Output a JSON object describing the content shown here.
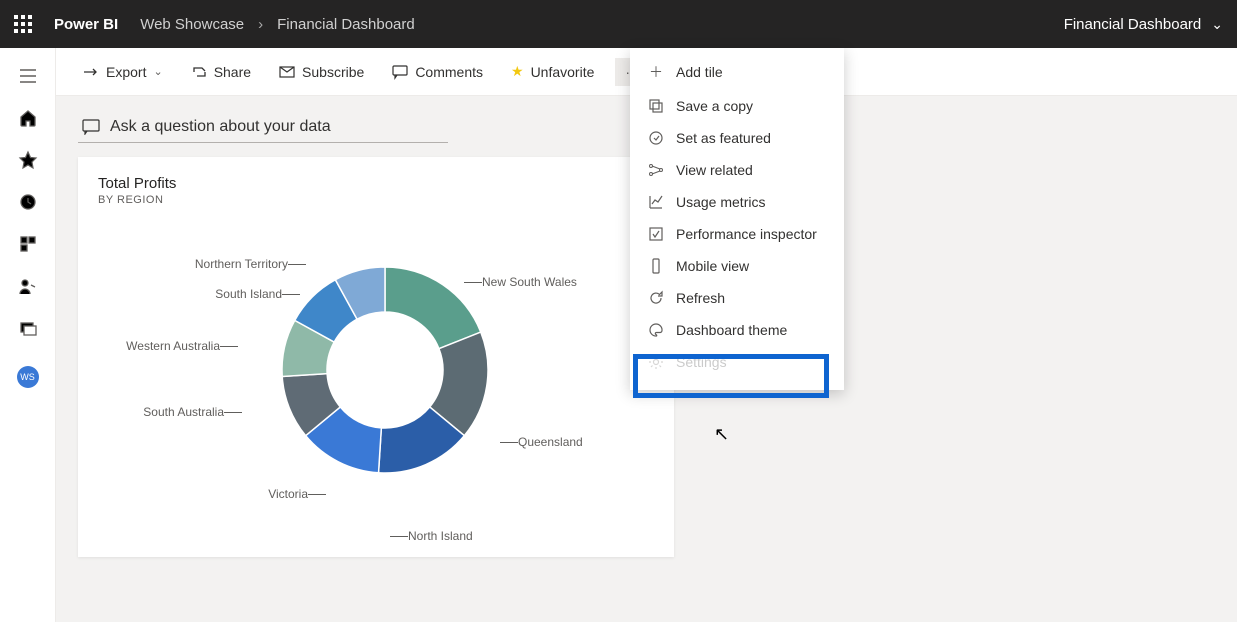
{
  "colors": {
    "accent": "#0e64d0",
    "star": "#f2c811"
  },
  "topbar": {
    "brand": "Power BI",
    "breadcrumb1": "Web Showcase",
    "breadcrumb2": "Financial Dashboard",
    "right_label": "Financial Dashboard"
  },
  "rail": {
    "avatar_initials": "WS"
  },
  "toolbar": {
    "export": "Export",
    "share": "Share",
    "subscribe": "Subscribe",
    "comments": "Comments",
    "unfavorite": "Unfavorite"
  },
  "qna": {
    "placeholder": "Ask a question about your data"
  },
  "tile": {
    "title": "Total Profits",
    "subtitle": "By Region"
  },
  "menu": {
    "items": [
      "Add tile",
      "Save a copy",
      "Set as featured",
      "View related",
      "Usage metrics",
      "Performance inspector",
      "Mobile view",
      "Refresh",
      "Dashboard theme",
      "Settings"
    ]
  },
  "chart_data": {
    "type": "donut",
    "title": "Total Profits",
    "subtitle": "BY REGION",
    "series": [
      {
        "name": "New South Wales",
        "value": 19,
        "color": "#5a9e8c"
      },
      {
        "name": "Queensland",
        "value": 17,
        "color": "#5c6b73"
      },
      {
        "name": "North Island",
        "value": 15,
        "color": "#2b5ea8"
      },
      {
        "name": "Victoria",
        "value": 13,
        "color": "#3a79d6"
      },
      {
        "name": "South Australia",
        "value": 10,
        "color": "#5f6b75"
      },
      {
        "name": "Western Australia",
        "value": 9,
        "color": "#8fb9a8"
      },
      {
        "name": "South Island",
        "value": 9,
        "color": "#3f87c9"
      },
      {
        "name": "Northern Territory",
        "value": 8,
        "color": "#7fa9d6"
      }
    ],
    "label_positions": {
      "New South Wales": {
        "top": 62,
        "left": 404,
        "side": "right"
      },
      "Queensland": {
        "top": 222,
        "left": 440,
        "side": "right"
      },
      "North Island": {
        "top": 316,
        "left": 330,
        "side": "right"
      },
      "Victoria": {
        "top": 274,
        "left": 140,
        "side": "left"
      },
      "South Australia": {
        "top": 192,
        "left": 56,
        "side": "left"
      },
      "Western Australia": {
        "top": 126,
        "left": 52,
        "side": "left"
      },
      "South Island": {
        "top": 74,
        "left": 114,
        "side": "left"
      },
      "Northern Territory": {
        "top": 44,
        "left": 120,
        "side": "left"
      }
    }
  }
}
